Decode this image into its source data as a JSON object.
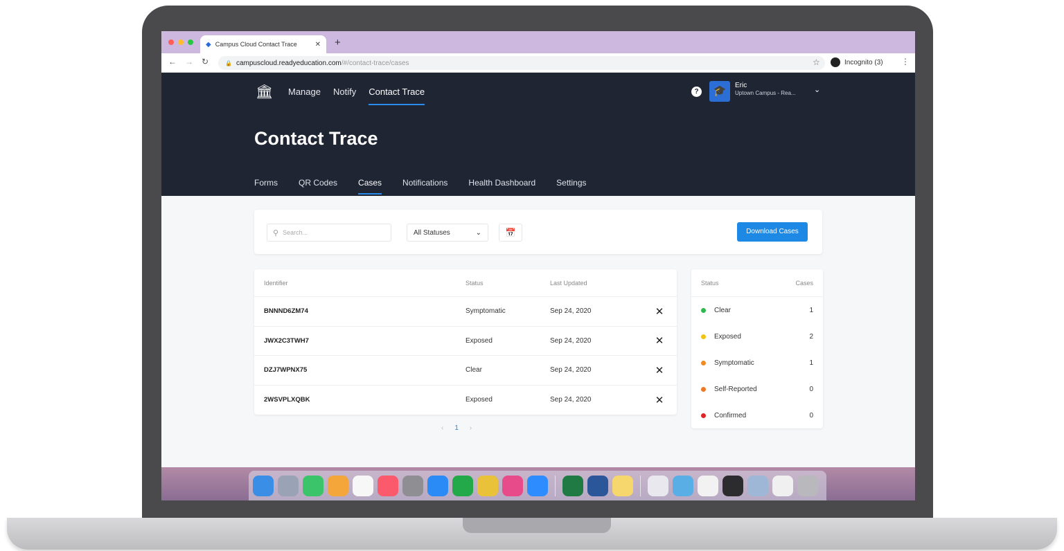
{
  "browser": {
    "tab_title": "Campus Cloud Contact Trace",
    "new_tab": "+",
    "url_host": "campuscloud.readyeducation.com",
    "url_path": "/#/contact-trace/cases",
    "incognito_label": "Incognito (3)"
  },
  "header": {
    "nav": [
      "Manage",
      "Notify",
      "Contact Trace"
    ],
    "active_nav": "Contact Trace",
    "user_name": "Eric",
    "user_campus": "Uptown Campus - Rea...",
    "help": "?"
  },
  "page": {
    "title": "Contact Trace",
    "subnav": [
      "Forms",
      "QR Codes",
      "Cases",
      "Notifications",
      "Health Dashboard",
      "Settings"
    ],
    "active_subnav": "Cases"
  },
  "filters": {
    "search_placeholder": "Search...",
    "status_select": "All Statuses",
    "download_label": "Download Cases"
  },
  "table": {
    "headers": {
      "identifier": "Identifier",
      "status": "Status",
      "last_updated": "Last Updated"
    },
    "rows": [
      {
        "id": "BNNND6ZM74",
        "status": "Symptomatic",
        "updated": "Sep 24, 2020"
      },
      {
        "id": "JWX2C3TWH7",
        "status": "Exposed",
        "updated": "Sep 24, 2020"
      },
      {
        "id": "DZJ7WPNX75",
        "status": "Clear",
        "updated": "Sep 24, 2020"
      },
      {
        "id": "2WSVPLXQBK",
        "status": "Exposed",
        "updated": "Sep 24, 2020"
      }
    ]
  },
  "pagination": {
    "prev": "‹",
    "current": "1",
    "next": "›"
  },
  "summary": {
    "headers": {
      "status": "Status",
      "cases": "Cases"
    },
    "rows": [
      {
        "label": "Clear",
        "count": "1",
        "color": "#2db84d"
      },
      {
        "label": "Exposed",
        "count": "2",
        "color": "#f2c40f"
      },
      {
        "label": "Symptomatic",
        "count": "1",
        "color": "#f08a24"
      },
      {
        "label": "Self-Reported",
        "count": "0",
        "color": "#f07824"
      },
      {
        "label": "Confirmed",
        "count": "0",
        "color": "#e02424"
      }
    ]
  },
  "colors": {
    "header_bg": "#1f2533",
    "accent": "#1e88e5",
    "content_bg": "#f6f7f9"
  },
  "dock_icons": [
    "finder-icon",
    "launchpad-icon",
    "facetime-icon",
    "photos-icon",
    "calendar-icon",
    "music-icon",
    "system-preferences-icon",
    "app-store-icon",
    "evernote-icon",
    "chrome-icon",
    "slack-icon",
    "zoom-icon",
    "excel-icon",
    "word-icon",
    "stickies-icon",
    "window-icon",
    "folder-icon",
    "window-icon",
    "window-icon",
    "window-icon",
    "window-icon",
    "trash-icon"
  ]
}
